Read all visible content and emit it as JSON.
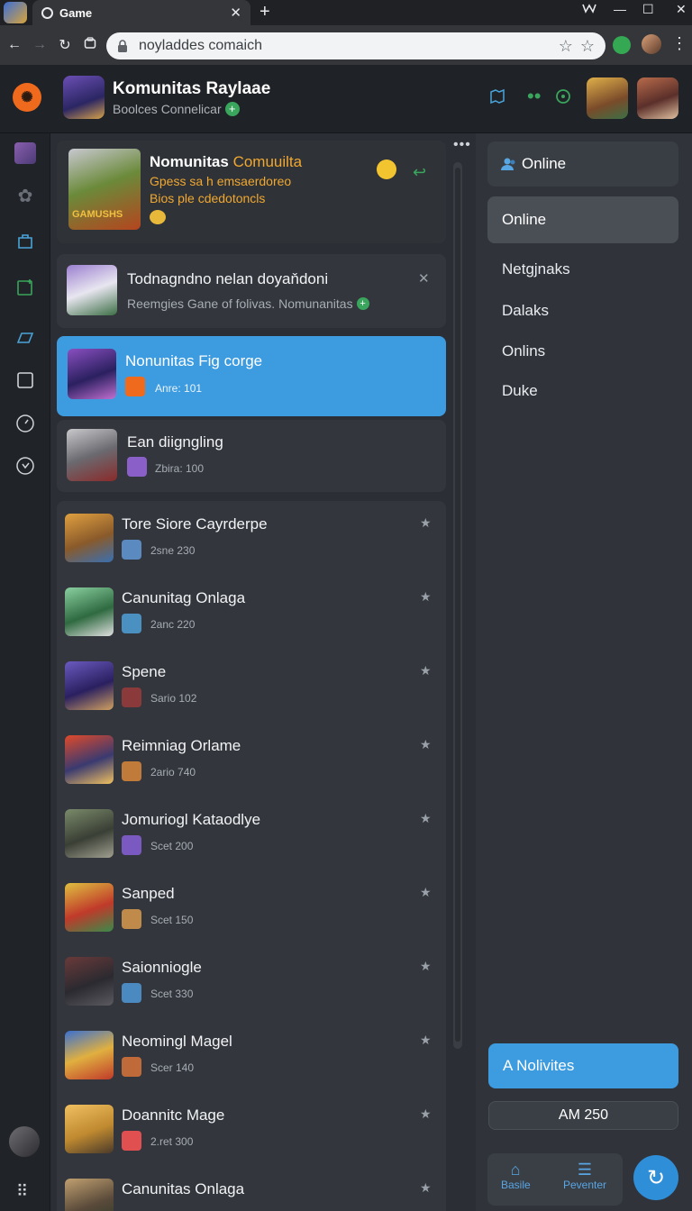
{
  "browser": {
    "tab_title": "Game",
    "tab_close": "✕",
    "new_tab": "+",
    "url": "noyladdes comaich",
    "window_controls": [
      "—",
      "☐",
      "✕"
    ]
  },
  "header": {
    "server_title": "Komunitas Raylaae",
    "server_subtitle": "Boolces Connelicar",
    "plus": "+"
  },
  "featured": {
    "title_white": "Nomunitas",
    "title_orange": "Comuuilta",
    "desc_line1": "Gpess sa h emsaerdoreo",
    "desc_line2": "Bios ple cdedotoncls",
    "badge_text": "GAMUSHS"
  },
  "notice": {
    "title": "Todnagndno nelan doyaňdoni",
    "subtitle": "Reemgies Gane of folivas. Nomunanitas",
    "close": "✕"
  },
  "selected_item": {
    "title": "Nonunitas Fig corge",
    "sub": "Anre: 101"
  },
  "second_item": {
    "title": "Ean diigngling",
    "sub": "Zbira: 100"
  },
  "list_items": [
    {
      "title": "Tore Siore Cayrderpe",
      "sub": "2sne 230"
    },
    {
      "title": "Canunitag Onlaga",
      "sub": "2anc 220"
    },
    {
      "title": "Spene",
      "sub": "Sario 102"
    },
    {
      "title": "Reimniag Orlame",
      "sub": "2ario 740"
    },
    {
      "title": "Jomuriogl Kataodlye",
      "sub": "Scet 200"
    },
    {
      "title": "Sanped",
      "sub": "Scet 150"
    },
    {
      "title": "Saionniogle",
      "sub": "Scet 330"
    },
    {
      "title": "Neomingl Magel",
      "sub": "Scer 140"
    },
    {
      "title": "Doannitc Mage",
      "sub": "2.ret 300"
    },
    {
      "title": "Canunitas Onlaga",
      "sub": ""
    }
  ],
  "right_panel": {
    "online_header": "Online",
    "online_selected": "Online",
    "items": [
      "Netgjnaks",
      "Dalaks",
      "Onlins",
      "Duke"
    ],
    "cta": "A Nolivites",
    "am_value": "AM 250",
    "nav": [
      {
        "label": "Basile",
        "icon": "home-icon"
      },
      {
        "label": "Peventer",
        "icon": "list-icon"
      }
    ]
  },
  "colors": {
    "accent_blue": "#3d9be0",
    "brand_orange": "#f06a1e",
    "featured_orange": "#f0a830",
    "online_green": "#3aa55c"
  }
}
